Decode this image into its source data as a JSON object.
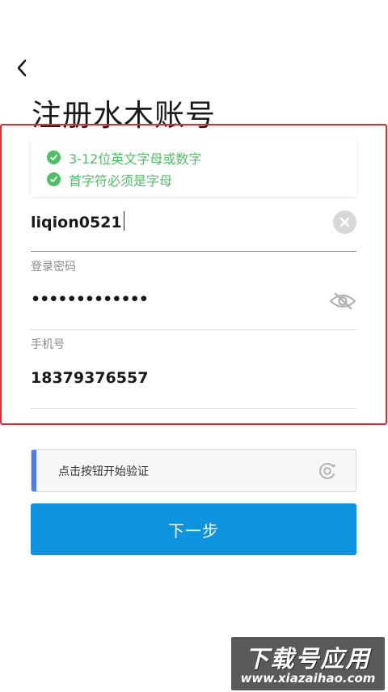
{
  "header": {
    "title": "注册水木账号"
  },
  "hints": [
    {
      "text": "3-12位英文字母或数字"
    },
    {
      "text": "首字符必须是字母"
    }
  ],
  "username": {
    "value": "liqion0521"
  },
  "password": {
    "label": "登录密码",
    "value": "•••••••••••••"
  },
  "phone": {
    "label": "手机号",
    "value": "18379376557"
  },
  "verify": {
    "text": "点击按钮开始验证"
  },
  "next_button": {
    "label": "下一步"
  },
  "watermark": {
    "title": "下载号应用",
    "url": "www.xiazaihao.com"
  },
  "colors": {
    "accent": "#0d93df",
    "success": "#4cc063",
    "highlight_border": "#e32b2b",
    "verify_bar": "#4a7cf0"
  },
  "icons": {
    "back": "chevron-left-icon",
    "hint_check": "check-circle-icon",
    "clear": "clear-icon",
    "password_toggle": "eye-off-icon",
    "verify": "refresh-verify-icon"
  }
}
